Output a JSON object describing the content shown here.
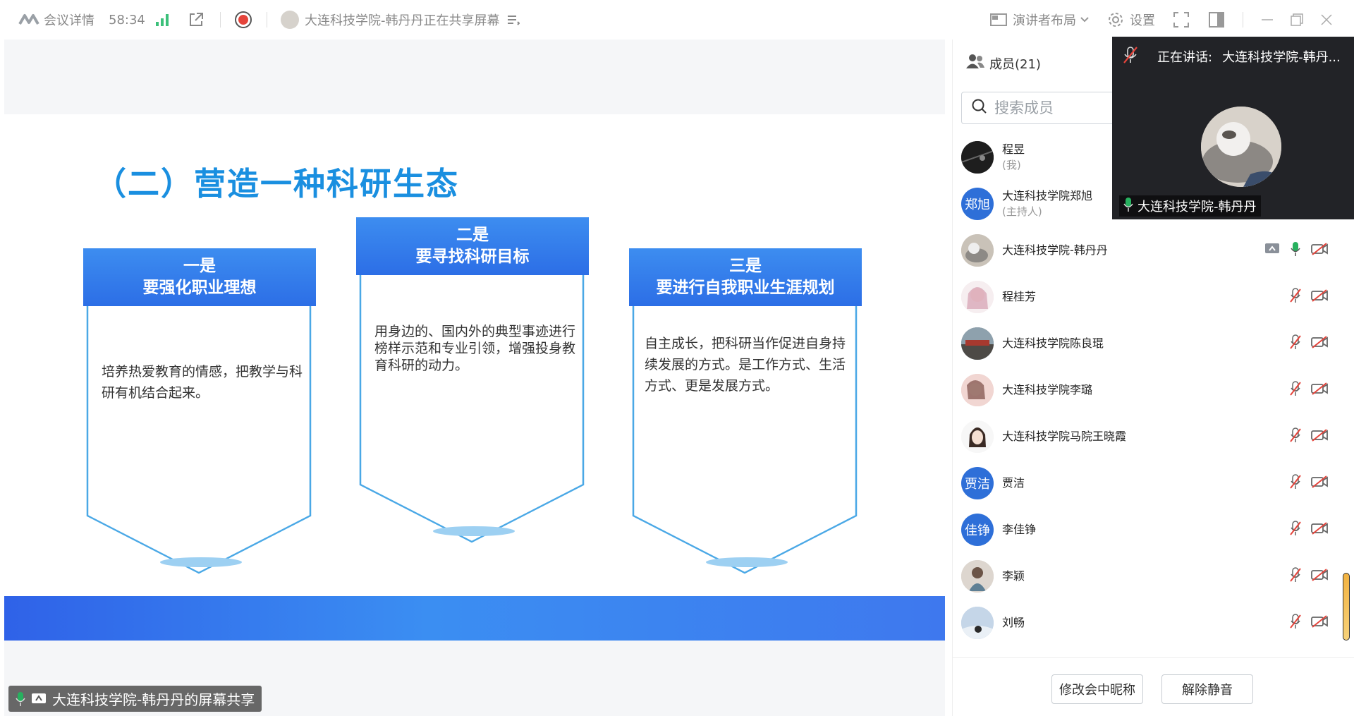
{
  "topbar": {
    "meeting_details": "会议详情",
    "duration": "58:34",
    "sharing_status": "大连科技学院-韩丹丹正在共享屏幕",
    "layout_label": "演讲者布局",
    "settings_label": "设置"
  },
  "slide": {
    "title": "（二）营造一种科研生态",
    "cards": [
      {
        "head_line1": "一是",
        "head_line2": "要强化职业理想",
        "body": "培养热爱教育的情感，把教学与科研有机结合起来。"
      },
      {
        "head_line1": "二是",
        "head_line2": "要寻找科研目标",
        "body": "用身边的、国内外的典型事迹进行榜样示范和专业引领，增强投身教育科研的动力。"
      },
      {
        "head_line1": "三是",
        "head_line2": "要进行自我职业生涯规划",
        "body": "自主成长，把科研当作促进自身持续发展的方式。是工作方式、生活方式、更是发展方式。"
      }
    ]
  },
  "share_label": "大连科技学院-韩丹丹的屏幕共享",
  "panel": {
    "members_title": "成员(21)",
    "search_placeholder": "搜索成员",
    "members": [
      {
        "name": "程昱",
        "sub": "(我)"
      },
      {
        "name": "大连科技学院郑旭",
        "sub": "(主持人)",
        "avatar_text": "郑旭"
      },
      {
        "name": "大连科技学院-韩丹丹"
      },
      {
        "name": "程桂芳"
      },
      {
        "name": "大连科技学院陈良琨"
      },
      {
        "name": "大连科技学院李璐"
      },
      {
        "name": "大连科技学院马院王晓霞"
      },
      {
        "name": "贾洁",
        "avatar_text": "贾洁"
      },
      {
        "name": "李佳铮",
        "avatar_text": "佳铮"
      },
      {
        "name": "李颖"
      },
      {
        "name": "刘畅"
      }
    ],
    "rename_button": "修改会中昵称",
    "unmute_button": "解除静音"
  },
  "speaker": {
    "speaking_label": "正在讲话:",
    "speaking_name": "大连科技学院-韩丹...",
    "video_name": "大连科技学院-韩丹丹"
  },
  "colors": {
    "accent": "#2e6fd8",
    "slide_blue": "#1a8fe0",
    "record_red": "#e5443b",
    "mic_green": "#27b15f"
  }
}
